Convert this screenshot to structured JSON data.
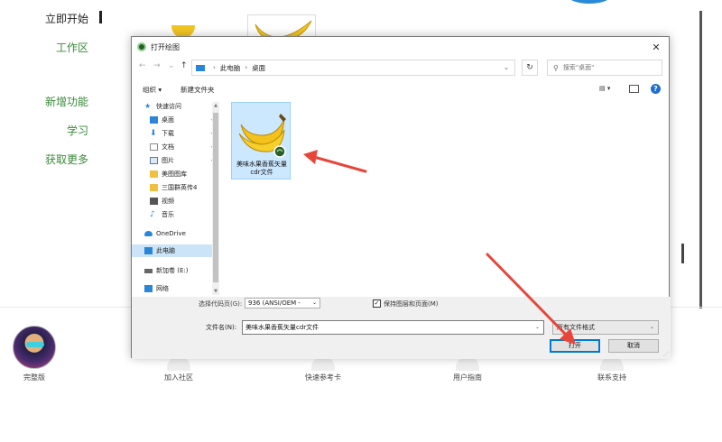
{
  "app": {
    "nav": [
      {
        "label": "立即开始",
        "active": true
      },
      {
        "label": "工作区"
      },
      {
        "label": "新增功能"
      },
      {
        "label": "学习"
      },
      {
        "label": "获取更多"
      }
    ],
    "bottom_links": [
      "完整版",
      "加入社区",
      "快速参考卡",
      "用户指南",
      "联系支持"
    ]
  },
  "dialog": {
    "title": "打开绘图",
    "close_glyph": "✕",
    "address": {
      "root": "此电脑",
      "current": "桌面"
    },
    "search_placeholder": "搜索\"桌面\"",
    "toolbar": {
      "organize": "组织 ▾",
      "new_folder": "新建文件夹"
    },
    "nav_items": [
      {
        "label": "快速访问",
        "icon": "star-icon",
        "color": "#2a86d8"
      },
      {
        "label": "桌面",
        "icon": "desktop-icon",
        "color": "#2a86d8",
        "pinned": true
      },
      {
        "label": "下载",
        "icon": "download-icon",
        "color": "#2a86d8",
        "pinned": true
      },
      {
        "label": "文档",
        "icon": "document-icon",
        "color": "#8a8a8a",
        "pinned": true
      },
      {
        "label": "图片",
        "icon": "picture-icon",
        "color": "#5a7da8",
        "pinned": true
      },
      {
        "label": "美图图库",
        "icon": "folder-icon",
        "color": "#f0c040"
      },
      {
        "label": "三国群英传4",
        "icon": "folder-icon",
        "color": "#f0c040"
      },
      {
        "label": "视频",
        "icon": "video-icon",
        "color": "#555555"
      },
      {
        "label": "音乐",
        "icon": "music-icon",
        "color": "#2a86d8"
      },
      {
        "label": "OneDrive",
        "icon": "cloud-icon",
        "color": "#2a86d8"
      },
      {
        "label": "此电脑",
        "icon": "computer-icon",
        "color": "#2a86d8",
        "selected": true
      },
      {
        "label": "新加卷 (E:)",
        "icon": "drive-icon",
        "color": "#666666"
      },
      {
        "label": "网络",
        "icon": "network-icon",
        "color": "#2a86d8"
      }
    ],
    "file": {
      "name": "美味水果香蕉矢量cdr文件"
    },
    "codepage_label": "选择代码页(G):",
    "codepage_value": "936  (ANSI/OEM -",
    "keep_checkbox": {
      "label": "保持图层和页面(M)",
      "checked": true
    },
    "filename_label": "文件名(N):",
    "filename_value": "美味水果香蕉矢量cdr文件",
    "filetype_value": "所有文件格式",
    "open_label": "打开",
    "cancel_label": "取消"
  },
  "colors": {
    "accent": "#0078d7",
    "arrow": "#e8453a",
    "nav_green": "#3a8a3a"
  }
}
